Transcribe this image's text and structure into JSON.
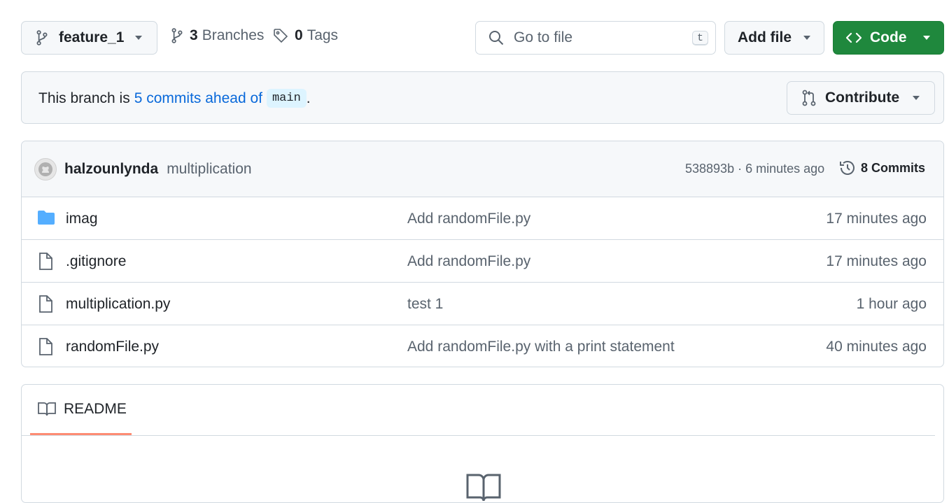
{
  "toolbar": {
    "branch_name": "feature_1",
    "branches_count": "3",
    "branches_label": "Branches",
    "tags_count": "0",
    "tags_label": "Tags",
    "search_placeholder": "Go to file",
    "search_shortcut": "t",
    "add_file_label": "Add file",
    "code_label": "Code"
  },
  "banner": {
    "prefix": "This branch is",
    "ahead_link": "5 commits ahead of",
    "base_branch": "main",
    "suffix": ".",
    "contribute_label": "Contribute"
  },
  "latest_commit": {
    "author": "halzounlynda",
    "message": "multiplication",
    "meta": "538893b · 6 minutes ago",
    "commits_label": "8 Commits"
  },
  "files": [
    {
      "name": "imag",
      "type": "folder",
      "commit": "Add randomFile.py",
      "date": "17 minutes ago"
    },
    {
      "name": ".gitignore",
      "type": "file",
      "commit": "Add randomFile.py",
      "date": "17 minutes ago"
    },
    {
      "name": "multiplication.py",
      "type": "file",
      "commit": "test 1",
      "date": "1 hour ago"
    },
    {
      "name": "randomFile.py",
      "type": "file",
      "commit": "Add randomFile.py with a print statement",
      "date": "40 minutes ago"
    }
  ],
  "readme": {
    "tab_label": "README"
  },
  "colors": {
    "code_button": "#1f883d",
    "link": "#0969da",
    "folder": "#54aeff",
    "tab_underline": "#fd8c73"
  }
}
